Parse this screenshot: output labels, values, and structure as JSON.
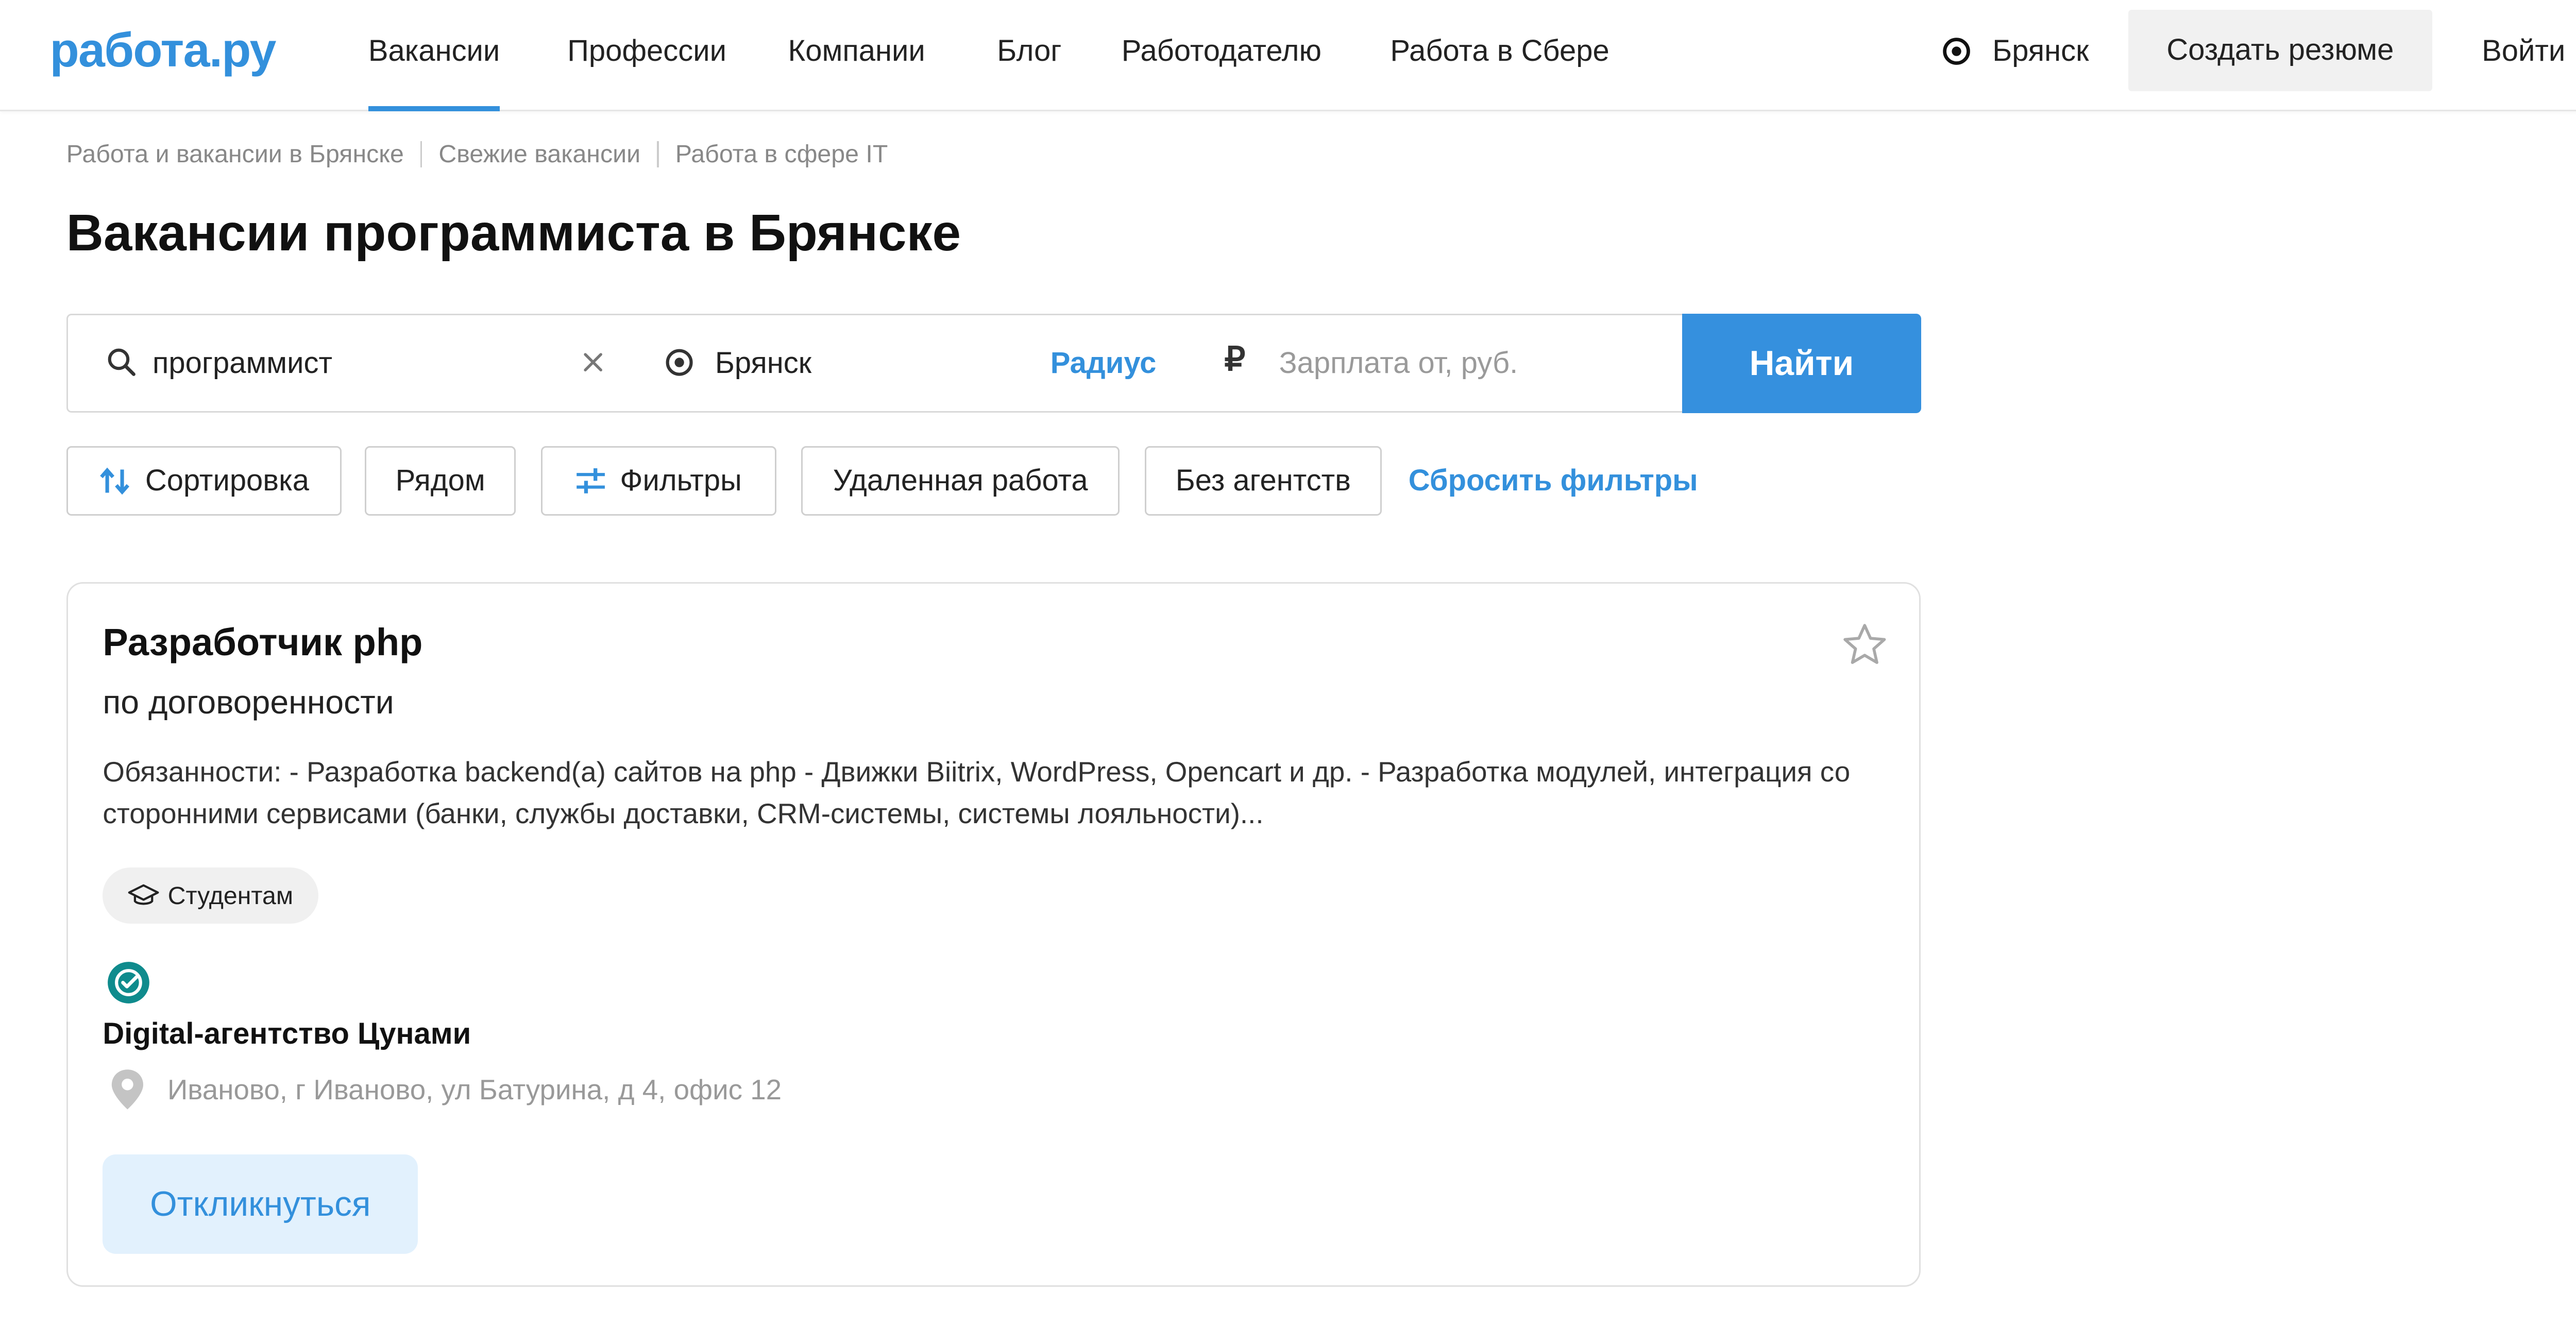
{
  "header": {
    "logo": "работа.ру",
    "nav": [
      "Вакансии",
      "Профессии",
      "Компании",
      "Блог",
      "Работодателю",
      "Работа в Сбере"
    ],
    "city": "Брянск",
    "create_resume": "Создать резюме",
    "login": "Войти",
    "accent_color": "#3390dc"
  },
  "breadcrumbs": [
    "Работа и вакансии в Брянске",
    "Свежие вакансии",
    "Работа в сфере IT"
  ],
  "page_title": "Вакансии программиста в Брянске",
  "search": {
    "query": "программист",
    "city": "Брянск",
    "radius_label": "Радиус",
    "salary_placeholder": "Зарплата от, руб.",
    "find_button": "Найти"
  },
  "filters": {
    "sort": "Сортировка",
    "nearby": "Рядом",
    "filters": "Фильтры",
    "remote": "Удаленная работа",
    "no_agencies": "Без агентств",
    "reset": "Сбросить фильтры"
  },
  "vacancy": {
    "title": "Разработчик php",
    "salary": "по договоренности",
    "description": "Обязанности: - Разработка backend(a) сайтов на php - Движки Biitrix, WordPress, Opencart и др. - Разработка модулей, интеграция со сторонними сервисами (банки, службы доставки, CRM-системы, системы лояльности)...",
    "tag": "Студентам",
    "company": "Digital-агентство Цунами",
    "address": "Иваново, г Иваново, ул Батурина, д 4, офис 12",
    "apply_button": "Откликнуться",
    "verified_icon": "verified-check-icon",
    "verified_color": "#0f8b8d"
  }
}
